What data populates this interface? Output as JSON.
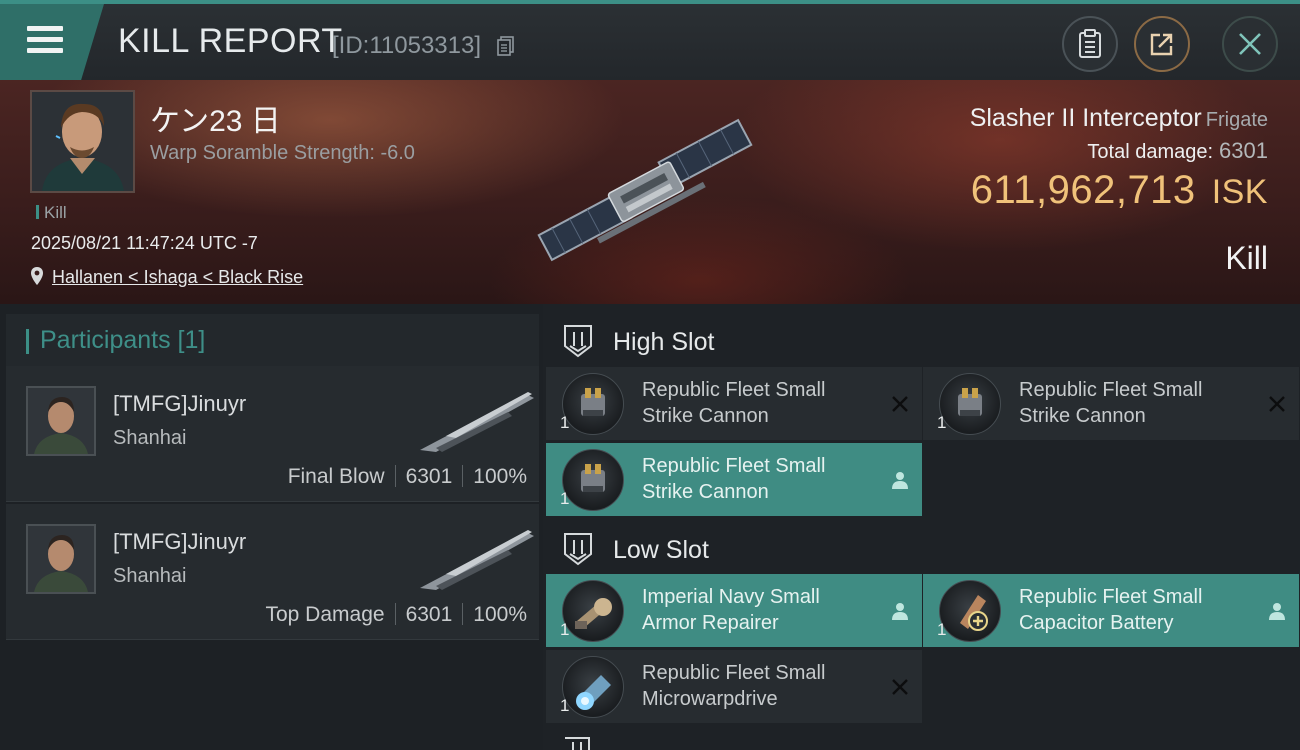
{
  "header": {
    "title": "KILL REPORT",
    "report_id": "[ID:11053313]"
  },
  "victim": {
    "pilot_name": "ケン23 日",
    "warp_scramble": "Warp Soramble Strength: -6.0",
    "tag": "Kill",
    "datetime": "2025/08/21 11:47:24 UTC -7",
    "location": "Hallanen < Ishaga < Black Rise",
    "ship_name": "Slasher II Interceptor",
    "ship_class": "Frigate",
    "total_damage_label": "Total damage:",
    "total_damage": "6301",
    "isk_value": "611,962,713",
    "isk_currency": "ISK",
    "result": "Kill"
  },
  "participants": {
    "heading": "Participants [1]",
    "rows": [
      {
        "name": "[TMFG]Jinuyr",
        "corp": "Shanhai",
        "role": "Final Blow",
        "damage": "6301",
        "percent": "100%"
      },
      {
        "name": "[TMFG]Jinuyr",
        "corp": "Shanhai",
        "role": "Top Damage",
        "damage": "6301",
        "percent": "100%"
      }
    ]
  },
  "fitting": {
    "high_slot_label": "High Slot",
    "low_slot_label": "Low Slot",
    "high": [
      {
        "name": "Republic Fleet Small\nStrike Cannon",
        "qty": "1",
        "status": "destroyed"
      },
      {
        "name": "Republic Fleet Small\nStrike Cannon",
        "qty": "1",
        "status": "destroyed"
      },
      {
        "name": "Republic Fleet Small\nStrike Cannon",
        "qty": "1",
        "status": "dropped"
      }
    ],
    "low": [
      {
        "name": "Imperial Navy Small\nArmor Repairer",
        "qty": "1",
        "status": "dropped"
      },
      {
        "name": "Republic Fleet Small\nCapacitor Battery",
        "qty": "1",
        "status": "dropped"
      },
      {
        "name": "Republic Fleet Small\nMicrowarpdrive",
        "qty": "1",
        "status": "destroyed"
      }
    ]
  },
  "colors": {
    "accent_teal": "#3c8f86",
    "isk_gold": "#f0c27a",
    "banner_red": "#4b2522"
  }
}
